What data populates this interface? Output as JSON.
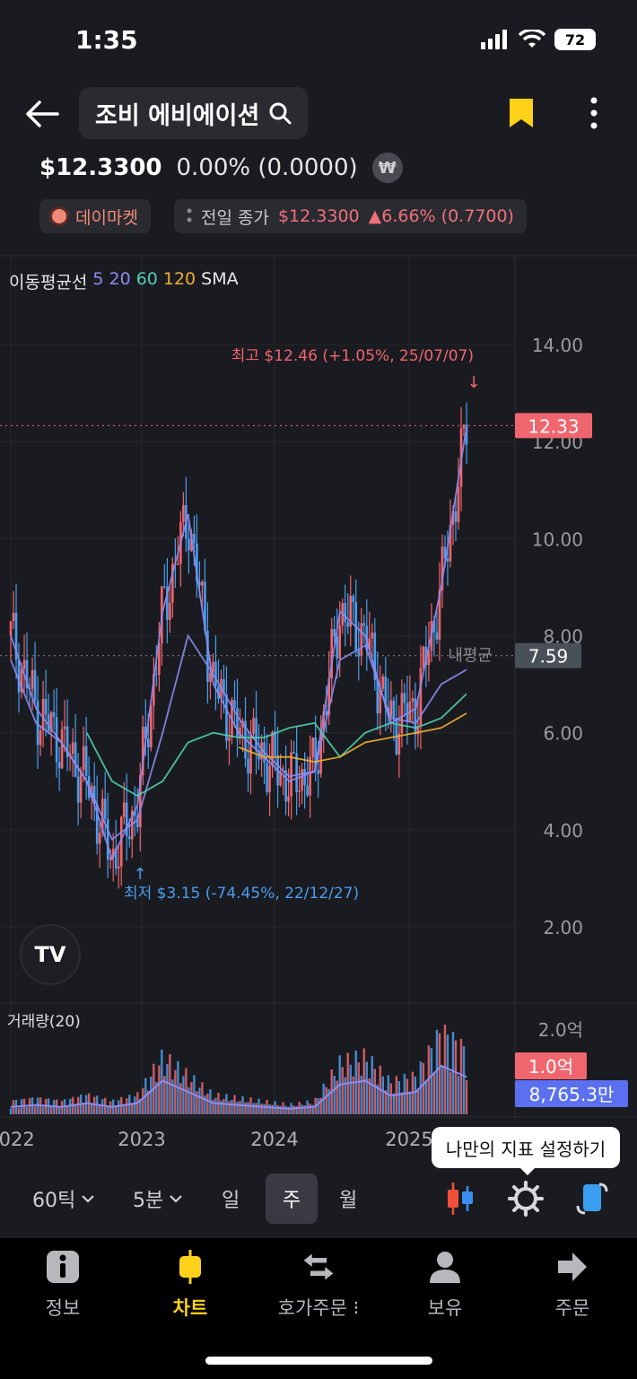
{
  "status_bar": {
    "time": "1:35",
    "battery": "72"
  },
  "header": {
    "stock_name": "조비 에비에이션"
  },
  "price": {
    "current": "$12.3300",
    "change": "0.00% (0.0000)",
    "currency_badge": "₩"
  },
  "chips": {
    "market": "데이마켓",
    "prev_close_label": "전일 종가",
    "prev_close_price": "$12.3300",
    "prev_close_change": "▲6.66% (0.7700)"
  },
  "ma_legend": {
    "label": "이동평균선",
    "p5": "5",
    "p20": "20",
    "p60": "60",
    "p120": "120",
    "type": "SMA"
  },
  "colors": {
    "up": "#f0666e",
    "down": "#4a9ef0",
    "ma5": "#8c8cf0",
    "ma20": "#8c8cf0",
    "ma60": "#4fd0b0",
    "ma120": "#f0b030",
    "accent": "#ffd21a"
  },
  "annotations": {
    "high": "최고 $12.46 (+1.05%, 25/07/07)",
    "low": "최저 $3.15 (-74.45%, 22/12/27)",
    "avg_label": "내평균"
  },
  "price_axis": {
    "ticks": [
      "14.00",
      "12.00",
      "10.00",
      "8.00",
      "6.00",
      "4.00",
      "2.00"
    ],
    "current_tag": "12.33",
    "avg_tag": "7.59"
  },
  "volume": {
    "label": "거래량(20)",
    "axis_top": "2.0억",
    "current_tag": "1.0억",
    "ma_tag": "8,765.3만"
  },
  "x_axis": {
    "labels": [
      "2022",
      "2023",
      "2024",
      "2025"
    ]
  },
  "tooltip": "나만의 지표 설정하기",
  "toolbar": {
    "tick": "60틱",
    "minute": "5분",
    "day": "일",
    "week": "주",
    "month": "월"
  },
  "bottom_nav": [
    {
      "label": "정보",
      "icon": "info-icon"
    },
    {
      "label": "차트",
      "icon": "candle-icon"
    },
    {
      "label": "호가주문",
      "icon": "swap-icon"
    },
    {
      "label": "보유",
      "icon": "person-icon"
    },
    {
      "label": "주문",
      "icon": "arrow-right-icon"
    }
  ],
  "chart_data": {
    "type": "line",
    "title": "",
    "y_range": [
      1.5,
      15.0
    ],
    "y_ticks": [
      14,
      12,
      10,
      8,
      6,
      4,
      2
    ],
    "current_price": 12.33,
    "average_price": 7.59,
    "high": 12.46,
    "low": 3.15,
    "x": [
      "2022-01",
      "2022-04",
      "2022-07",
      "2022-10",
      "2022-12",
      "2023-03",
      "2023-06",
      "2023-07",
      "2023-09",
      "2023-12",
      "2024-03",
      "2024-06",
      "2024-09",
      "2024-12",
      "2025-01",
      "2025-03",
      "2025-05",
      "2025-06",
      "2025-07"
    ],
    "series": [
      {
        "name": "5",
        "values": [
          8.0,
          6.5,
          5.8,
          5.0,
          3.4,
          4.5,
          8.5,
          10.5,
          7.0,
          6.0,
          5.5,
          5.0,
          5.2,
          8.5,
          8.0,
          6.2,
          6.5,
          9.0,
          12.3
        ]
      },
      {
        "name": "20",
        "values": [
          7.5,
          6.2,
          5.8,
          5.0,
          3.8,
          4.2,
          6.0,
          8.0,
          7.2,
          6.3,
          5.6,
          5.1,
          5.2,
          7.5,
          7.8,
          6.3,
          6.2,
          7.0,
          7.3
        ]
      },
      {
        "name": "60",
        "values": [
          null,
          null,
          null,
          6.0,
          5.0,
          4.7,
          5.0,
          5.8,
          6.0,
          5.9,
          5.9,
          6.1,
          6.2,
          5.5,
          6.0,
          6.2,
          6.1,
          6.3,
          6.8
        ]
      },
      {
        "name": "120",
        "values": [
          null,
          null,
          null,
          null,
          null,
          null,
          null,
          null,
          null,
          5.7,
          5.5,
          5.5,
          5.4,
          5.5,
          5.8,
          5.9,
          6.0,
          6.1,
          6.4
        ]
      }
    ],
    "volume_values": [
      0.2,
      0.25,
      0.2,
      0.3,
      0.2,
      0.3,
      0.9,
      0.6,
      0.3,
      0.25,
      0.2,
      0.15,
      0.2,
      0.8,
      0.9,
      0.5,
      0.6,
      1.3,
      1.0
    ],
    "volume_range": [
      0,
      2.2
    ]
  }
}
